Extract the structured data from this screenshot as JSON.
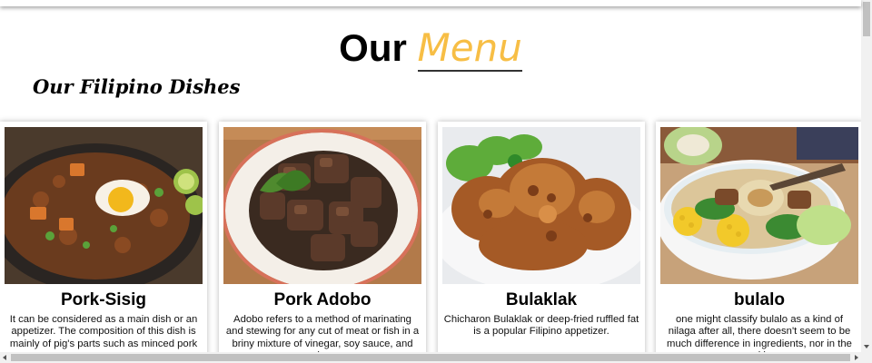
{
  "header": {
    "title_prefix": "Our",
    "title_accent": "Menu",
    "accent_color": "#f7be45"
  },
  "section": {
    "title": "Our Filipino Dishes"
  },
  "dishes": [
    {
      "name": "Pork-Sisig",
      "description": "It can be considered as a main dish or an appetizer. The composition of this dish is mainly of pig's parts such as minced pork",
      "image_icon": "pork-sisig-photo"
    },
    {
      "name": "Pork Adobo",
      "description": "Adobo refers to a method of marinating and stewing for any cut of meat or fish in a briny mixture of vinegar, soy sauce, and spices.",
      "image_icon": "pork-adobo-photo"
    },
    {
      "name": "Bulaklak",
      "description": "Chicharon Bulaklak or deep-fried ruffled fat is a popular Filipino appetizer.",
      "image_icon": "bulaklak-photo"
    },
    {
      "name": "bulalo",
      "description": "one might classify bulalo as a kind of nilaga after all, there doesn't seem to be much difference in ingredients, nor in the cooking",
      "image_icon": "bulalo-photo"
    }
  ]
}
